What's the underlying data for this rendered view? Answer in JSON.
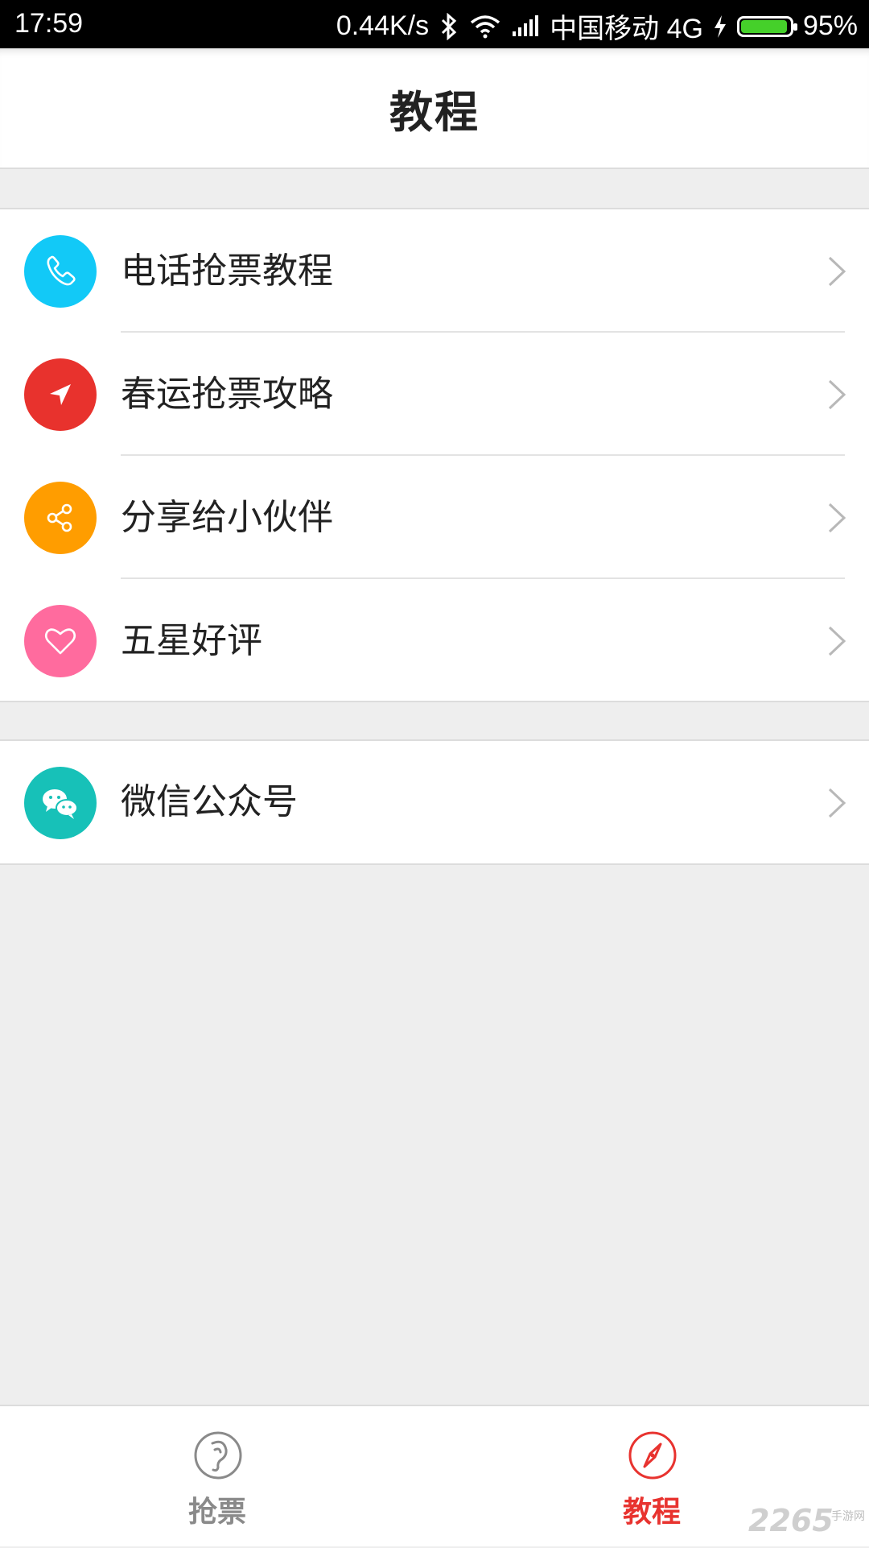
{
  "status_bar": {
    "time": "17:59",
    "speed": "0.44K/s",
    "carrier": "中国移动 4G",
    "battery": "95%",
    "battery_level": 0.95,
    "icons": [
      "bluetooth-icon",
      "wifi-icon",
      "signal-icon",
      "charging-icon",
      "battery-icon"
    ]
  },
  "header": {
    "title": "教程"
  },
  "menu": {
    "items": [
      {
        "label": "电话抢票教程",
        "icon": "phone-icon",
        "color": "#12c9f7"
      },
      {
        "label": "春运抢票攻略",
        "icon": "navigation-arrow-icon",
        "color": "#e8322d"
      },
      {
        "label": "分享给小伙伴",
        "icon": "share-icon",
        "color": "#ff9d00"
      },
      {
        "label": "五星好评",
        "icon": "heart-icon",
        "color": "#ff6b9e"
      }
    ],
    "extra": [
      {
        "label": "微信公众号",
        "icon": "wechat-icon",
        "color": "#17c1b8"
      }
    ]
  },
  "tabbar": {
    "tabs": [
      {
        "label": "抢票",
        "icon": "ear-phone-icon",
        "active": false
      },
      {
        "label": "教程",
        "icon": "compass-icon",
        "active": true
      }
    ],
    "active_color": "#e8332f",
    "inactive_color": "#8a8a8a"
  },
  "watermark": {
    "number": "2265",
    "site": "手游网"
  }
}
